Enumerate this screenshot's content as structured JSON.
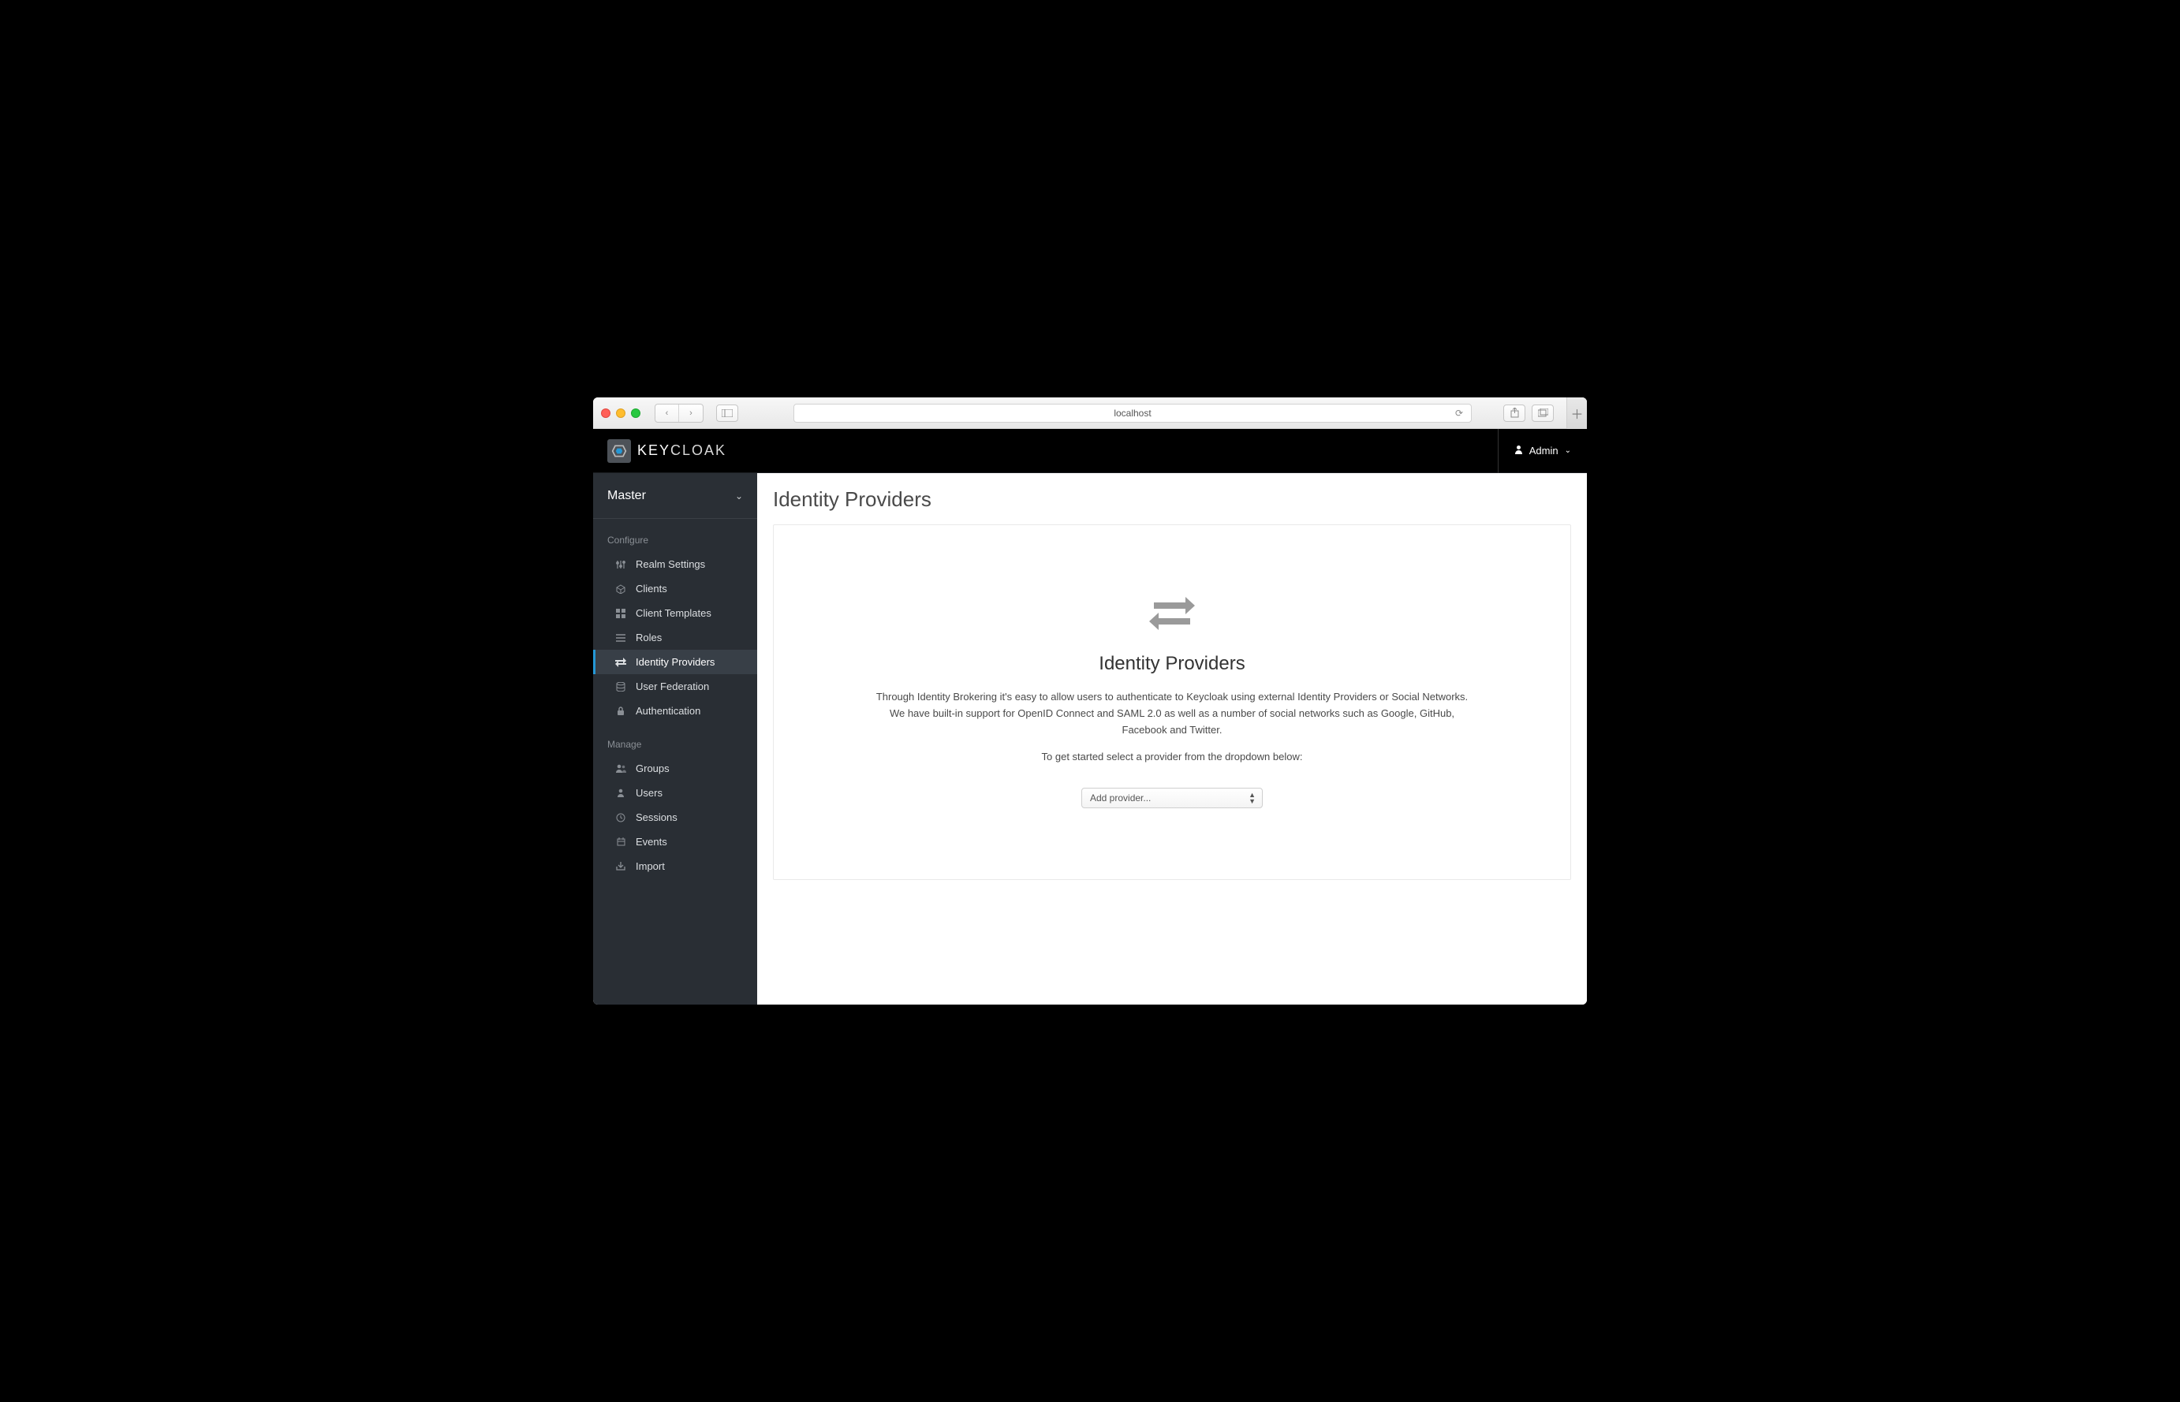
{
  "browser": {
    "url": "localhost"
  },
  "header": {
    "brand_main": "KEY",
    "brand_sub": "CLOAK",
    "user_label": "Admin"
  },
  "sidebar": {
    "realm": "Master",
    "sections": [
      {
        "label": "Configure",
        "items": [
          {
            "label": "Realm Settings",
            "icon": "sliders",
            "active": false
          },
          {
            "label": "Clients",
            "icon": "cube",
            "active": false
          },
          {
            "label": "Client Templates",
            "icon": "tiles",
            "active": false
          },
          {
            "label": "Roles",
            "icon": "list",
            "active": false
          },
          {
            "label": "Identity Providers",
            "icon": "exchange",
            "active": true
          },
          {
            "label": "User Federation",
            "icon": "database",
            "active": false
          },
          {
            "label": "Authentication",
            "icon": "lock",
            "active": false
          }
        ]
      },
      {
        "label": "Manage",
        "items": [
          {
            "label": "Groups",
            "icon": "users",
            "active": false
          },
          {
            "label": "Users",
            "icon": "user",
            "active": false
          },
          {
            "label": "Sessions",
            "icon": "clock",
            "active": false
          },
          {
            "label": "Events",
            "icon": "calendar",
            "active": false
          },
          {
            "label": "Import",
            "icon": "import",
            "active": false
          }
        ]
      }
    ]
  },
  "main": {
    "title": "Identity Providers",
    "empty_title": "Identity Providers",
    "empty_p1": "Through Identity Brokering it's easy to allow users to authenticate to Keycloak using external Identity Providers or Social Networks.",
    "empty_p2": "We have built-in support for OpenID Connect and SAML 2.0 as well as a number of social networks such as Google, GitHub, Facebook and Twitter.",
    "empty_p3": "To get started select a provider from the dropdown below:",
    "dropdown_label": "Add provider..."
  }
}
